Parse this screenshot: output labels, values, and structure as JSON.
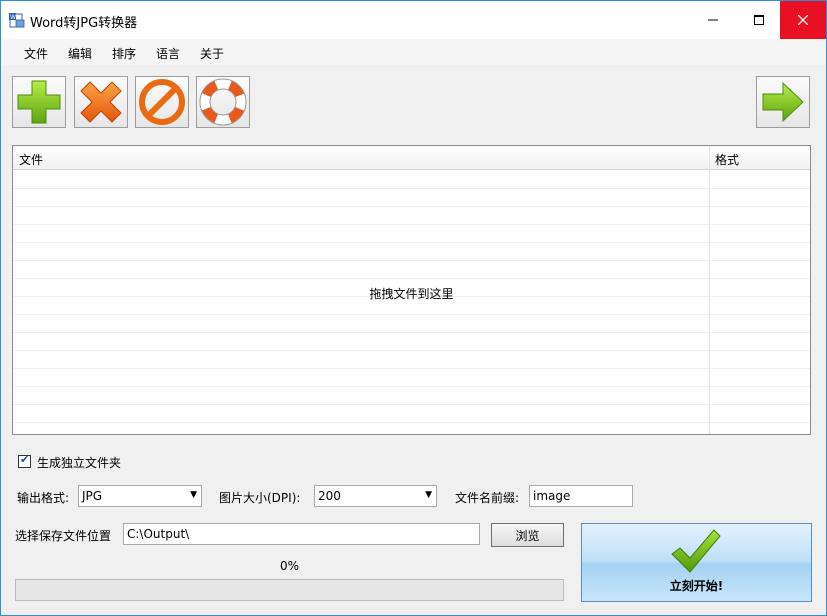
{
  "window": {
    "title": "Word转JPG转换器",
    "controls": {
      "minimize_icon": "minimize-icon",
      "maximize_icon": "maximize-icon",
      "close_icon": "close-icon"
    }
  },
  "menu": {
    "items": [
      "文件",
      "编辑",
      "排序",
      "语言",
      "关于"
    ]
  },
  "toolbar": {
    "buttons": [
      "add-icon",
      "remove-icon",
      "clear-icon",
      "help-lifebuoy-icon"
    ],
    "next_icon": "arrow-right-icon"
  },
  "file_list": {
    "columns": [
      "文件",
      "格式"
    ],
    "drop_hint": "拖拽文件到这里"
  },
  "options": {
    "separate_folder": {
      "label": "生成独立文件夹",
      "checked": true
    },
    "output_format": {
      "label": "输出格式:",
      "value": "JPG"
    },
    "image_size": {
      "label": "图片大小(DPI):",
      "value": "200"
    },
    "filename_prefix": {
      "label": "文件名前缀:",
      "value": "image"
    },
    "save_location": {
      "label": "选择保存文件位置",
      "value": "C:\\Output\\"
    },
    "browse_label": "浏览"
  },
  "progress": {
    "text": "0%",
    "fraction": 0
  },
  "start_button": {
    "label": "立刻开始!",
    "icon": "checkmark-icon"
  },
  "colors": {
    "accent_border": "#2f8fd6",
    "close_red": "#e81123",
    "green": "#7cc219",
    "orange": "#f06a10"
  }
}
